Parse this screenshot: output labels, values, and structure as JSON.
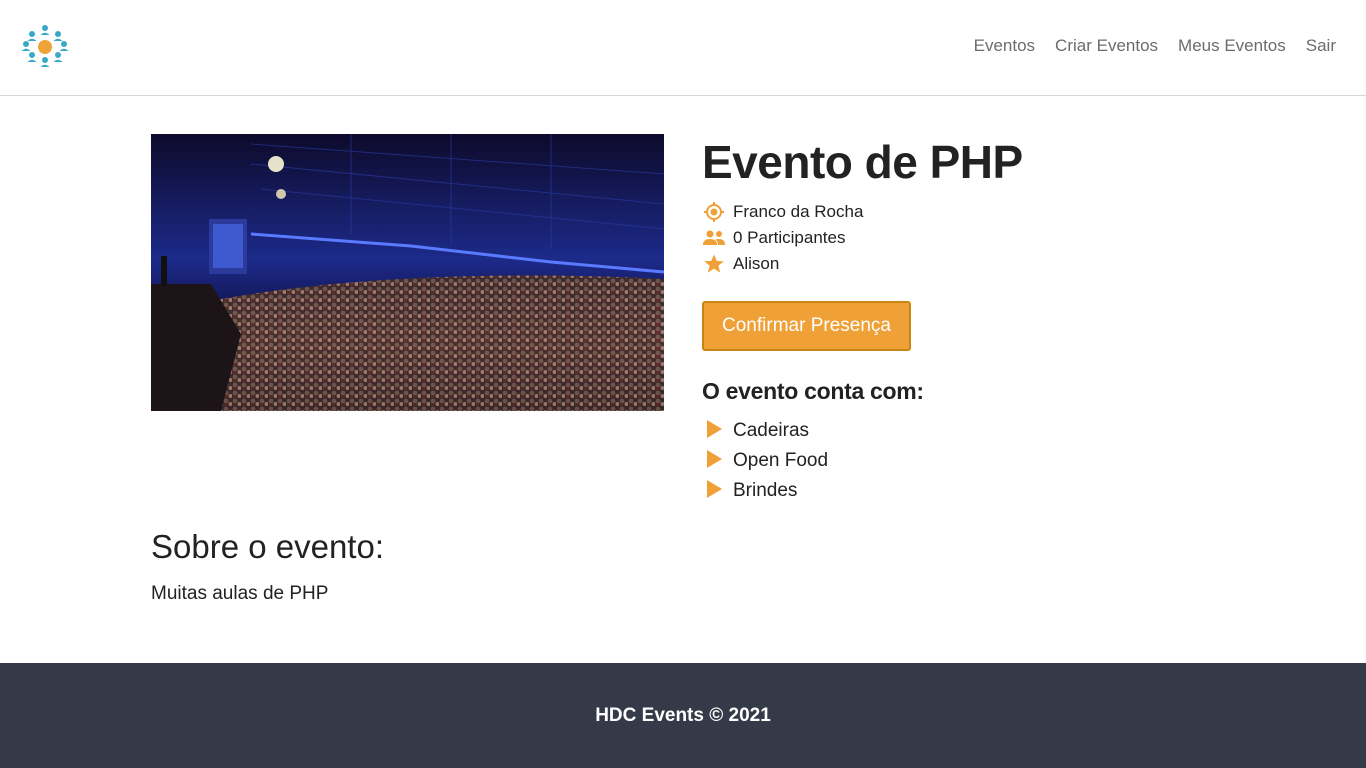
{
  "nav": {
    "logo_icon": "people-network-icon",
    "items": [
      {
        "label": "Eventos"
      },
      {
        "label": "Criar Eventos"
      },
      {
        "label": "Meus Eventos"
      },
      {
        "label": "Sair"
      }
    ]
  },
  "event": {
    "title": "Evento de PHP",
    "city": "Franco da Rocha",
    "participants": "0 Participantes",
    "owner": "Alison",
    "confirm_label": "Confirmar Presença",
    "features_title": "O evento conta com:",
    "features": [
      "Cadeiras",
      "Open Food",
      "Brindes"
    ],
    "about_title": "Sobre o evento:",
    "about_text": "Muitas aulas de PHP",
    "image_icon": "event-auditorium-photo"
  },
  "footer": {
    "text": "HDC Events © 2021"
  },
  "colors": {
    "accent": "#efa036",
    "accent_border": "#c98414",
    "logo_blue": "#3aa9c9",
    "footer_bg": "#343a47",
    "nav_text": "#6c6c6c"
  }
}
